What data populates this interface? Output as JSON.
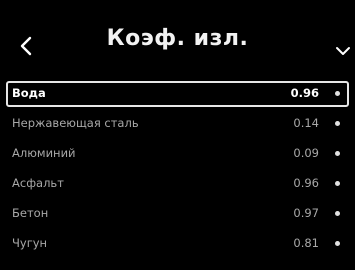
{
  "header": {
    "title": "Коэф. изл.",
    "back_icon": "chevron-left-icon",
    "menu_icon": "chevron-down-icon"
  },
  "materials": [
    {
      "name": "Вода",
      "value": "0.96",
      "selected": true
    },
    {
      "name": "Нержавеющая сталь",
      "value": "0.14",
      "selected": false
    },
    {
      "name": "Алюминий",
      "value": "0.09",
      "selected": false
    },
    {
      "name": "Асфальт",
      "value": "0.96",
      "selected": false
    },
    {
      "name": "Бетон",
      "value": "0.97",
      "selected": false
    },
    {
      "name": "Чугун",
      "value": "0.81",
      "selected": false
    }
  ],
  "colors": {
    "background": "#000000",
    "text": "#ffffff",
    "text_dim": "#a8a8a8",
    "selection_border": "#e6e6e6"
  }
}
